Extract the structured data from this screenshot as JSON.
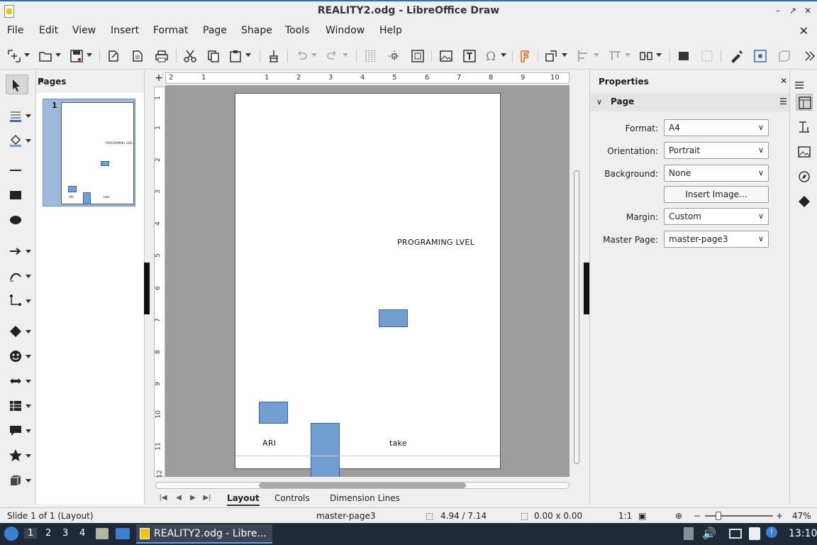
{
  "window": {
    "title": "REALITY2.odg - LibreOffice Draw",
    "minimize": "–",
    "maximize": "↗",
    "close": "✕"
  },
  "menu": {
    "items": [
      "File",
      "Edit",
      "View",
      "Insert",
      "Format",
      "Page",
      "Shape",
      "Tools",
      "Window",
      "Help"
    ],
    "close_doc": "✕"
  },
  "pages_panel": {
    "title": "Pages",
    "close": "✕",
    "slide_number": "1",
    "thumb_texts": [
      "PROGRAMING LVEL",
      "ARI",
      "take"
    ]
  },
  "rulers": {
    "h_labels": [
      "2",
      "1",
      "1",
      "2",
      "3",
      "4",
      "5",
      "6",
      "7",
      "8",
      "9",
      "10"
    ],
    "v_labels": [
      "1",
      "1",
      "2",
      "3",
      "4",
      "5",
      "6",
      "7",
      "8",
      "9",
      "10",
      "11",
      "12"
    ]
  },
  "page_content": {
    "text_programing": "PROGRAMING LVEL",
    "text_ari": "ARI",
    "text_take": "take"
  },
  "tabs": {
    "items": [
      "Layout",
      "Controls",
      "Dimension Lines"
    ],
    "active": "Layout"
  },
  "properties": {
    "title": "Properties",
    "section": "Page",
    "format_label": "Format:",
    "format_value": "A4",
    "orientation_label": "Orientation:",
    "orientation_value": "Portrait",
    "background_label": "Background:",
    "background_value": "None",
    "insert_image": "Insert Image...",
    "margin_label": "Margin:",
    "margin_value": "Custom",
    "master_label": "Master Page:",
    "master_value": "master-page3"
  },
  "statusbar": {
    "slide": "Slide 1 of 1 (Layout)",
    "master": "master-page3",
    "position": "4.94 / 7.14",
    "size": "0.00 x 0.00",
    "scale": "1:1",
    "zoom": "47%",
    "zoom_minus": "−",
    "zoom_plus": "+"
  },
  "taskbar": {
    "workspaces": [
      "1",
      "2",
      "3",
      "4"
    ],
    "app_label": "REALITY2.odg - Libre...",
    "clock": "13:10"
  },
  "colors": {
    "shape_fill": "#729fcf",
    "shape_stroke": "#3465a4",
    "accent": "#2c6fb5",
    "taskbar": "#1f2a38"
  }
}
